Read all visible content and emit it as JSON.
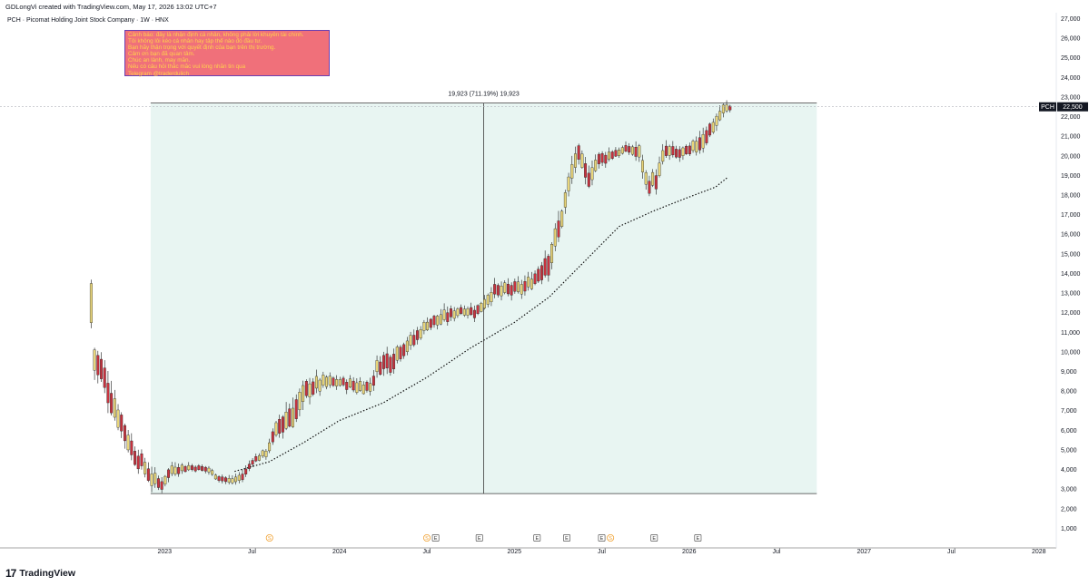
{
  "header": {
    "credit": "GDLongVi created with TradingView.com, May 17, 2026 13:02 UTC+7",
    "symbol_line": "PCH · Picomat Holding Joint Stock Company · 1W · HNX"
  },
  "note": {
    "lines": [
      "Cảnh báo: đây là nhận định cá nhân, không phải lời khuyên tài chính.",
      "Tôi không lôi kéo cá nhân hay tập thể nào đó đầu tư.",
      "Bạn hãy thận trọng với quyết định của bạn trên thị trường.",
      "Cảm ơn bạn đã quan tâm.",
      "Chúc an lành, may mắn.",
      "Nếu có câu hỏi thắc mắc vui lòng nhắn tin qua",
      "Telegram @traderdulich"
    ],
    "bg_color": "#f0707a",
    "text_color": "#ffd24d",
    "border_color": "#6a3fb2"
  },
  "measure_label": "19,923 (711.19%) 19,923",
  "price_tag": {
    "symbol": "PCH",
    "value": "22,500"
  },
  "logo_text": "TradingView",
  "colors": {
    "up": "#e8d57a",
    "down": "#c8333f",
    "wick": "#1a1a1a",
    "measure_fill": "#e8f5f2",
    "ma_line": "#111111",
    "event_orange": "#f0a030",
    "axis_text": "#131722"
  },
  "events": [
    {
      "label": "S",
      "kind": "split",
      "date": 2023.6
    },
    {
      "label": "S",
      "kind": "split",
      "date": 2024.5
    },
    {
      "label": "E",
      "kind": "earnings",
      "date": 2024.55
    },
    {
      "label": "E",
      "kind": "earnings",
      "date": 2024.8
    },
    {
      "label": "E",
      "kind": "earnings",
      "date": 2025.13
    },
    {
      "label": "E",
      "kind": "earnings",
      "date": 2025.3
    },
    {
      "label": "E",
      "kind": "earnings",
      "date": 2025.5
    },
    {
      "label": "S",
      "kind": "split",
      "date": 2025.55
    },
    {
      "label": "E",
      "kind": "earnings",
      "date": 2025.8
    },
    {
      "label": "E",
      "kind": "earnings",
      "date": 2026.05
    }
  ],
  "chart_data": {
    "type": "candlestick",
    "title": "PCH · Picomat Holding Joint Stock Company · 1W · HNX",
    "x_axis": {
      "ticks": [
        {
          "label": "2023",
          "date": 2023.0
        },
        {
          "label": "Jul",
          "date": 2023.5
        },
        {
          "label": "2024",
          "date": 2024.0
        },
        {
          "label": "Jul",
          "date": 2024.5
        },
        {
          "label": "2025",
          "date": 2025.0
        },
        {
          "label": "Jul",
          "date": 2025.5
        },
        {
          "label": "2026",
          "date": 2026.0
        },
        {
          "label": "Jul",
          "date": 2026.5
        },
        {
          "label": "2027",
          "date": 2027.0
        },
        {
          "label": "Jul",
          "date": 2027.5
        },
        {
          "label": "2028",
          "date": 2028.0
        }
      ],
      "range": [
        2022.1,
        2028.1
      ]
    },
    "y_axis": {
      "ticks": [
        "1,000",
        "2,000",
        "3,000",
        "4,000",
        "5,000",
        "6,000",
        "7,000",
        "8,000",
        "9,000",
        "10,000",
        "11,000",
        "12,000",
        "13,000",
        "14,000",
        "15,000",
        "16,000",
        "17,000",
        "18,000",
        "19,000",
        "20,000",
        "21,000",
        "22,000",
        "23,000",
        "24,000",
        "25,000",
        "26,000",
        "27,000"
      ],
      "range": [
        0,
        27300
      ]
    },
    "last_price": 22500,
    "measure": {
      "start_date": 2022.92,
      "end_date": 2026.73,
      "low": 2770,
      "high": 22690,
      "label": "19,923 (711.19%) 19,923"
    },
    "anchors": [
      [
        2022.58,
        11500,
        13500
      ],
      [
        2022.6,
        9000,
        10000
      ],
      [
        2022.64,
        8500,
        9500
      ],
      [
        2022.7,
        7000,
        8000
      ],
      [
        2022.76,
        5800,
        6600
      ],
      [
        2022.82,
        4500,
        5200
      ],
      [
        2022.88,
        3900,
        4500
      ],
      [
        2022.93,
        3200,
        3800
      ],
      [
        2022.98,
        3000,
        3400
      ],
      [
        2023.04,
        3800,
        4200
      ],
      [
        2023.15,
        4000,
        4200
      ],
      [
        2023.25,
        3900,
        4100
      ],
      [
        2023.3,
        3500,
        3700
      ],
      [
        2023.38,
        3300,
        3500
      ],
      [
        2023.45,
        3500,
        3800
      ],
      [
        2023.5,
        4300,
        4500
      ],
      [
        2023.58,
        4700,
        5000
      ],
      [
        2023.65,
        5800,
        6500
      ],
      [
        2023.75,
        6500,
        7500
      ],
      [
        2023.82,
        7800,
        8500
      ],
      [
        2023.92,
        8200,
        8700
      ],
      [
        2024.0,
        8300,
        8600
      ],
      [
        2024.1,
        8000,
        8500
      ],
      [
        2024.18,
        8000,
        8400
      ],
      [
        2024.22,
        9000,
        9600
      ],
      [
        2024.3,
        9200,
        10000
      ],
      [
        2024.35,
        9800,
        10400
      ],
      [
        2024.42,
        10300,
        10800
      ],
      [
        2024.5,
        11200,
        11600
      ],
      [
        2024.6,
        11500,
        12000
      ],
      [
        2024.7,
        12000,
        12300
      ],
      [
        2024.78,
        11800,
        12200
      ],
      [
        2024.88,
        12800,
        13300
      ],
      [
        2024.96,
        12900,
        13400
      ],
      [
        2025.05,
        13000,
        13500
      ],
      [
        2025.12,
        13500,
        14000
      ],
      [
        2025.2,
        14200,
        15200
      ],
      [
        2025.26,
        16000,
        16800
      ],
      [
        2025.32,
        18500,
        19200
      ],
      [
        2025.36,
        19800,
        20500
      ],
      [
        2025.42,
        18500,
        19200
      ],
      [
        2025.48,
        19500,
        20000
      ],
      [
        2025.58,
        20000,
        20300
      ],
      [
        2025.66,
        20200,
        20500
      ],
      [
        2025.72,
        19800,
        20400
      ],
      [
        2025.76,
        18200,
        18800
      ],
      [
        2025.82,
        18500,
        19200
      ],
      [
        2025.86,
        20000,
        20500
      ],
      [
        2025.93,
        19900,
        20300
      ],
      [
        2026.0,
        20000,
        20400
      ],
      [
        2026.08,
        20500,
        21200
      ],
      [
        2026.14,
        21300,
        21800
      ],
      [
        2026.2,
        22200,
        22600
      ],
      [
        2026.25,
        22400,
        22500
      ]
    ],
    "moving_average": [
      [
        2023.4,
        3900
      ],
      [
        2023.6,
        4400
      ],
      [
        2023.8,
        5400
      ],
      [
        2024.0,
        6500
      ],
      [
        2024.25,
        7400
      ],
      [
        2024.5,
        8700
      ],
      [
        2024.75,
        10200
      ],
      [
        2025.0,
        11500
      ],
      [
        2025.2,
        12800
      ],
      [
        2025.4,
        14600
      ],
      [
        2025.6,
        16400
      ],
      [
        2025.8,
        17200
      ],
      [
        2026.0,
        17900
      ],
      [
        2026.15,
        18400
      ],
      [
        2026.22,
        18900
      ]
    ]
  }
}
